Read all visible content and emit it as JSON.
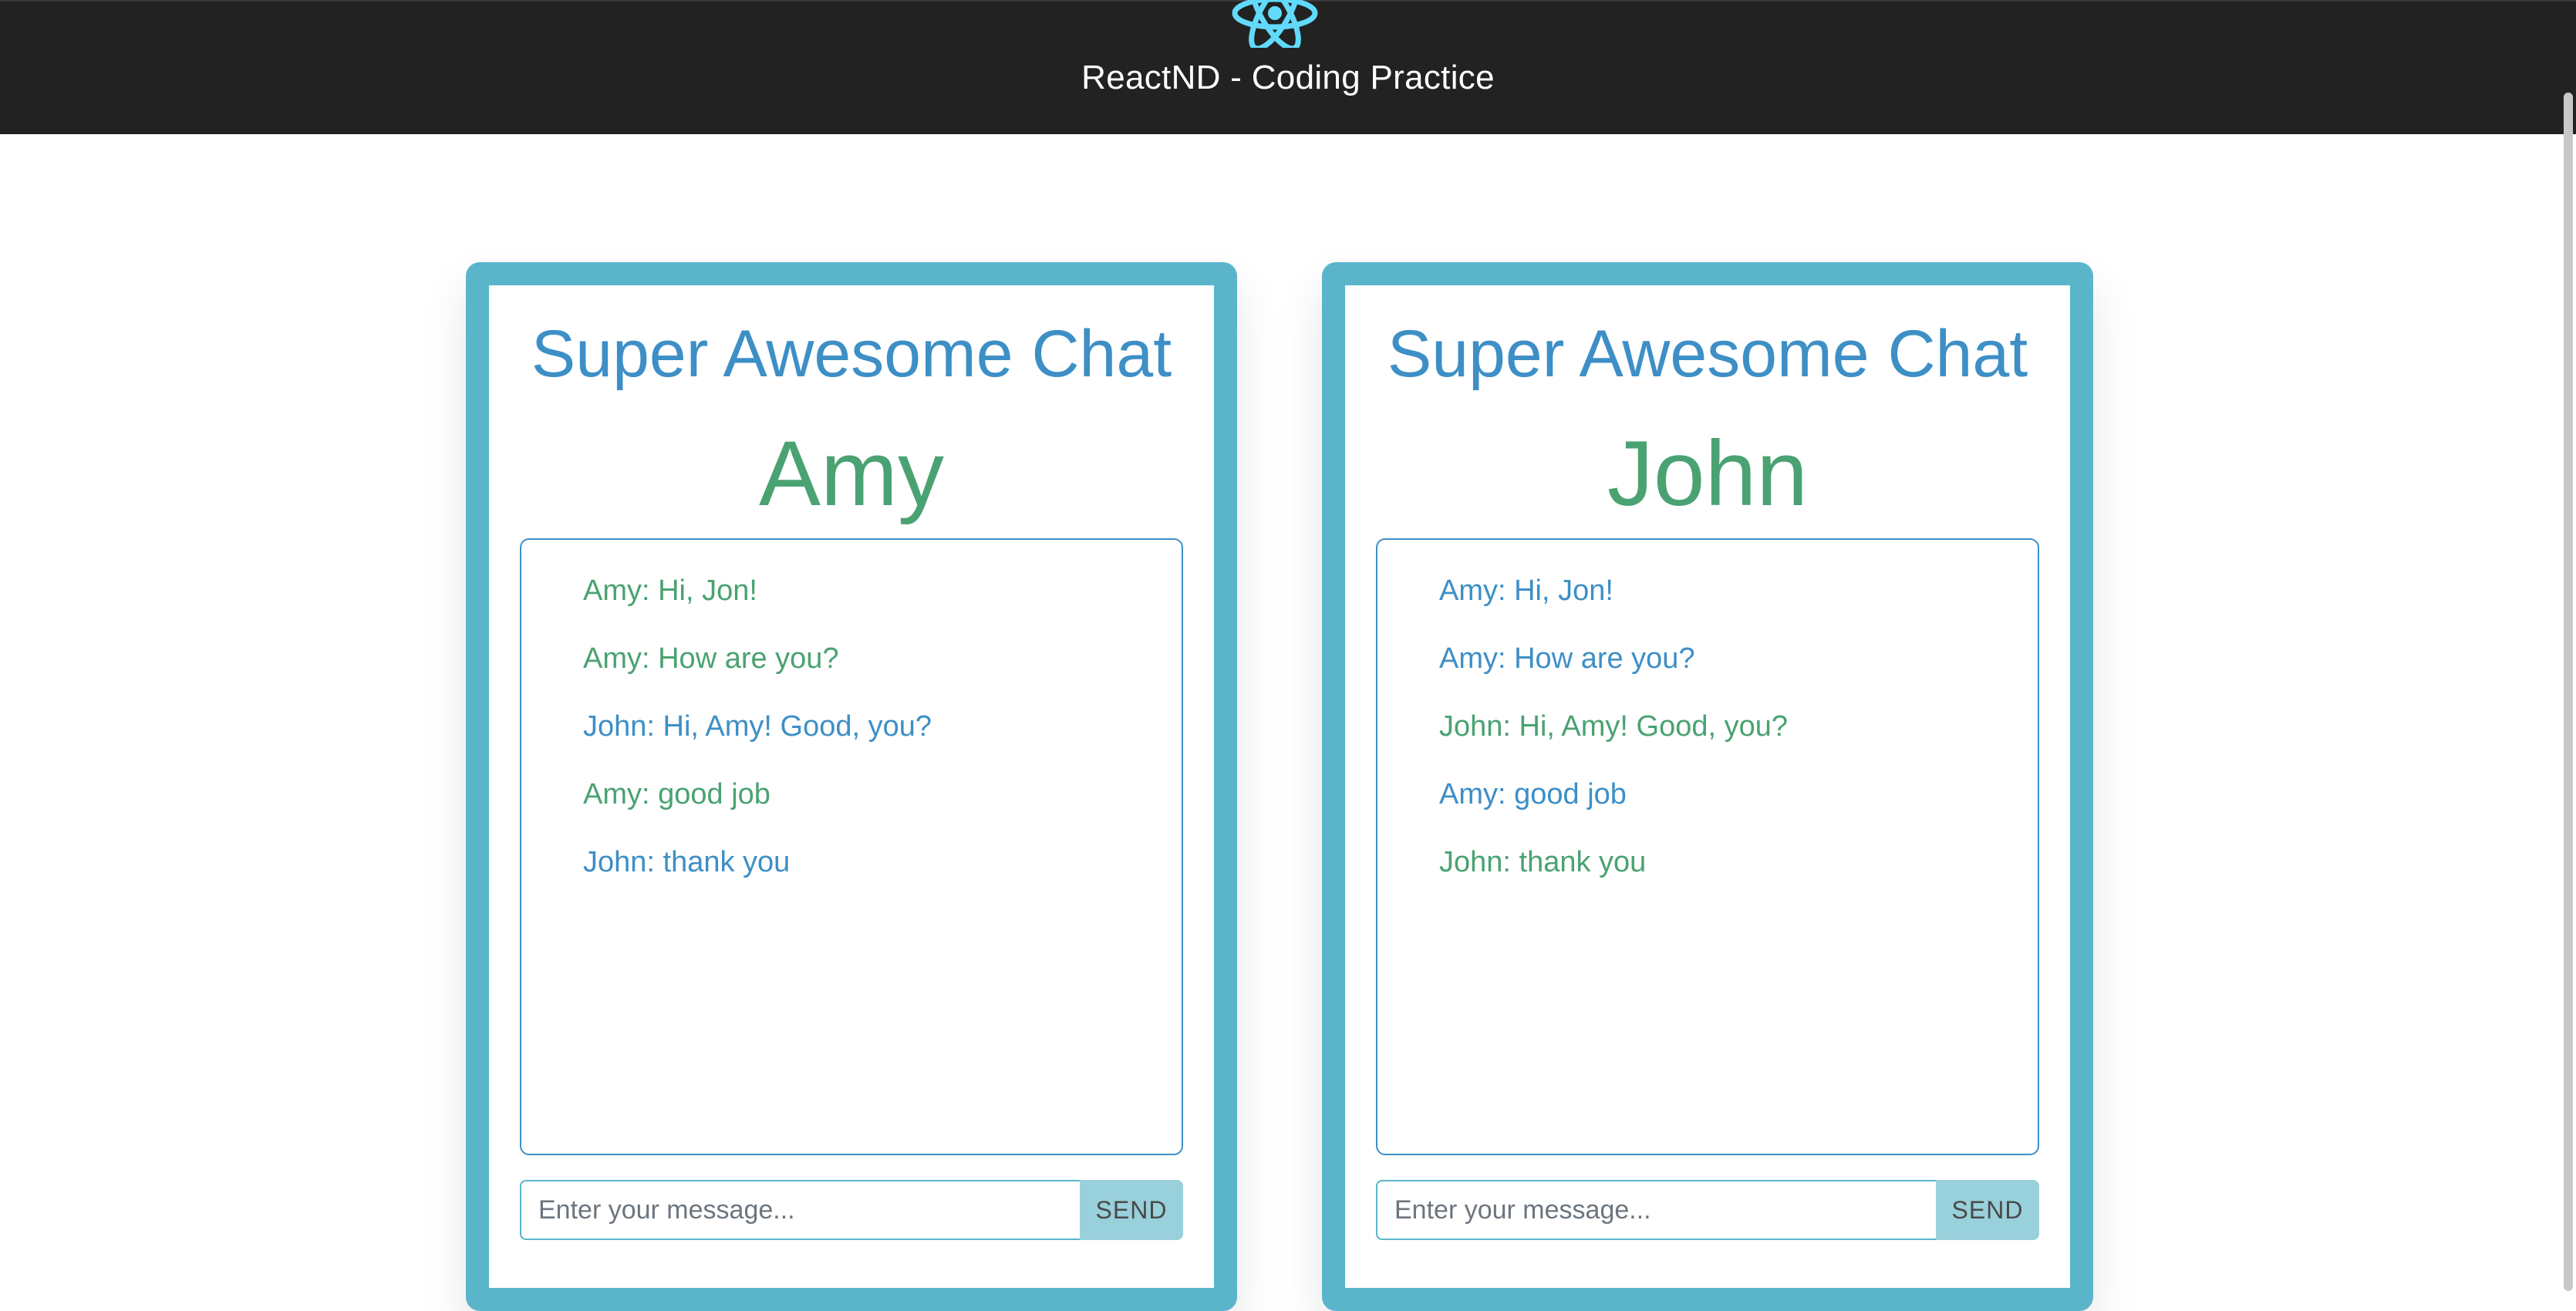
{
  "header": {
    "title": "ReactND - Coding Practice",
    "logo_icon": "react-logo-icon"
  },
  "colors": {
    "header_bg": "#222222",
    "frame": "#5bb5ca",
    "heading_blue": "#3d8fc6",
    "user_green": "#4aa272",
    "send_button": "#98d0db"
  },
  "chats": [
    {
      "heading": "Super Awesome Chat",
      "user": "Amy",
      "messages": [
        {
          "text": "Amy: Hi, Jon!"
        },
        {
          "text": "Amy: How are you?"
        },
        {
          "text": "John: Hi, Amy! Good, you?"
        },
        {
          "text": "Amy: good job"
        },
        {
          "text": "John: thank you"
        }
      ],
      "input_placeholder": "Enter your message...",
      "send_label": "SEND"
    },
    {
      "heading": "Super Awesome Chat",
      "user": "John",
      "messages": [
        {
          "text": "Amy: Hi, Jon!"
        },
        {
          "text": "Amy: How are you?"
        },
        {
          "text": "John: Hi, Amy! Good, you?"
        },
        {
          "text": "Amy: good job"
        },
        {
          "text": "John: thank you"
        }
      ],
      "input_placeholder": "Enter your message...",
      "send_label": "SEND"
    }
  ]
}
